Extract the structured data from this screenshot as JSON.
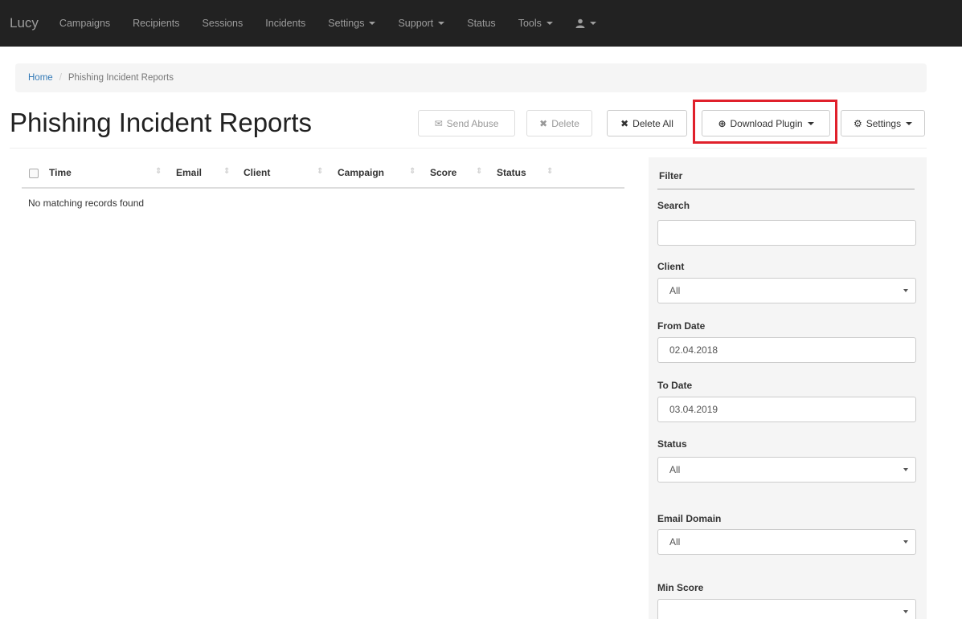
{
  "nav": {
    "brand": "Lucy",
    "items": [
      {
        "label": "Campaigns",
        "caret": false
      },
      {
        "label": "Recipients",
        "caret": false
      },
      {
        "label": "Sessions",
        "caret": false
      },
      {
        "label": "Incidents",
        "caret": false
      },
      {
        "label": "Settings",
        "caret": true
      },
      {
        "label": "Support",
        "caret": true
      },
      {
        "label": "Status",
        "caret": false
      },
      {
        "label": "Tools",
        "caret": true
      }
    ],
    "user_icon": "user-icon"
  },
  "breadcrumb": {
    "home": "Home",
    "separator": "/",
    "current": "Phishing Incident Reports"
  },
  "page": {
    "title": "Phishing Incident Reports"
  },
  "toolbar": {
    "send_abuse": "Send Abuse",
    "delete": "Delete",
    "delete_all": "Delete All",
    "download_plugin": "Download Plugin",
    "settings": "Settings",
    "highlight_color": "#e0202b"
  },
  "table": {
    "columns": [
      "Time",
      "Email",
      "Client",
      "Campaign",
      "Score",
      "Status"
    ],
    "empty_text": "No matching records found"
  },
  "filter": {
    "title": "Filter",
    "search_label": "Search",
    "search_value": "",
    "client_label": "Client",
    "client_value": "All",
    "from_date_label": "From Date",
    "from_date_value": "02.04.2018",
    "to_date_label": "To Date",
    "to_date_value": "03.04.2019",
    "status_label": "Status",
    "status_value": "All",
    "email_domain_label": "Email Domain",
    "email_domain_value": "All",
    "min_score_label": "Min Score",
    "min_score_value": ""
  }
}
